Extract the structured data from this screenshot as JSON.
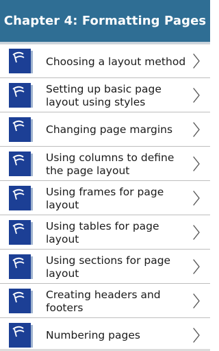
{
  "header": {
    "title": "Chapter 4: Formatting Pages"
  },
  "items": [
    {
      "label": "Choosing a layout method",
      "icon": "document-icon"
    },
    {
      "label": "Setting up basic page layout using styles",
      "icon": "document-icon"
    },
    {
      "label": "Changing page margins",
      "icon": "document-icon"
    },
    {
      "label": "Using columns to define the page layout",
      "icon": "document-icon"
    },
    {
      "label": "Using frames for page layout",
      "icon": "document-icon"
    },
    {
      "label": "Using tables for page layout",
      "icon": "document-icon"
    },
    {
      "label": "Using sections for page layout",
      "icon": "document-icon"
    },
    {
      "label": "Creating headers and footers",
      "icon": "document-icon"
    },
    {
      "label": "Numbering pages",
      "icon": "document-icon"
    }
  ],
  "colors": {
    "header_bg": "#2f6e94",
    "icon_blue": "#1c3f95",
    "text": "#1a1a1a"
  }
}
